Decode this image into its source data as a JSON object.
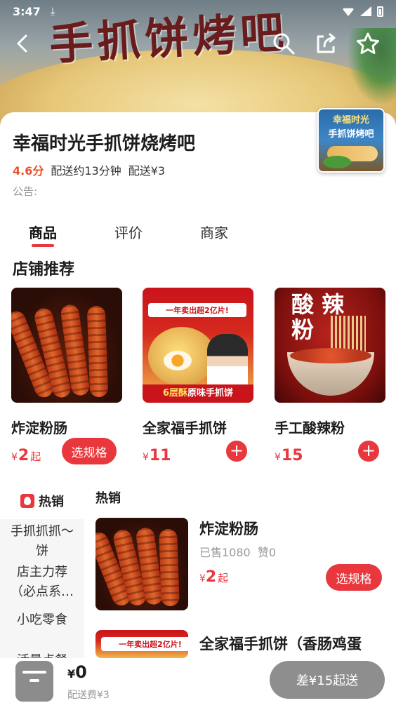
{
  "status_bar": {
    "time": "3:47",
    "download_icon": "download-arrow-icon"
  },
  "hero": {
    "title_art": "手抓饼烤吧"
  },
  "store": {
    "name": "幸福时光手抓饼烧烤吧",
    "rating": "4.6分",
    "delivery_time": "配送约13分钟",
    "delivery_fee": "配送¥3",
    "notice": "公告:",
    "logo_line1": "幸福时光",
    "logo_line2": "手抓饼烤吧"
  },
  "tabs": [
    {
      "label": "商品",
      "active": true
    },
    {
      "label": "评价",
      "active": false
    },
    {
      "label": "商家",
      "active": false
    }
  ],
  "recommended": {
    "title": "店铺推荐",
    "items": [
      {
        "name": "炸淀粉肠",
        "currency": "¥",
        "price": "2",
        "suffix": "起",
        "action": "选规格"
      },
      {
        "name": "全家福手抓饼",
        "currency": "¥",
        "price": "11",
        "action": "+"
      },
      {
        "name": "手工酸辣粉",
        "currency": "¥",
        "price": "15",
        "action": "+"
      }
    ],
    "image_text": {
      "cake_headline": "一年卖出超2亿片!",
      "cake_band_a": "6层酥",
      "cake_band_b": "原味手抓饼",
      "noodle_line1": "酸 辣",
      "noodle_line2": "粉"
    }
  },
  "categories": {
    "hot": "热销",
    "items": [
      "手抓抓抓～饼",
      "店主力荐（必点系…",
      "小吃零食",
      "活量点餐"
    ]
  },
  "list": {
    "title": "热销",
    "items": [
      {
        "name": "炸淀粉肠",
        "sold": "已售1080",
        "likes": "赞0",
        "currency": "¥",
        "price": "2",
        "suffix": "起",
        "action": "选规格"
      },
      {
        "name": "全家福手抓饼（香肠鸡蛋"
      }
    ]
  },
  "cart": {
    "total_currency": "¥",
    "total": "0",
    "fee": "配送费¥3",
    "button": "差¥15起送"
  },
  "colors": {
    "accent": "#e8383d",
    "rating": "#e8502a",
    "muted": "#999999",
    "cart_btn": "#8e8e8e"
  }
}
